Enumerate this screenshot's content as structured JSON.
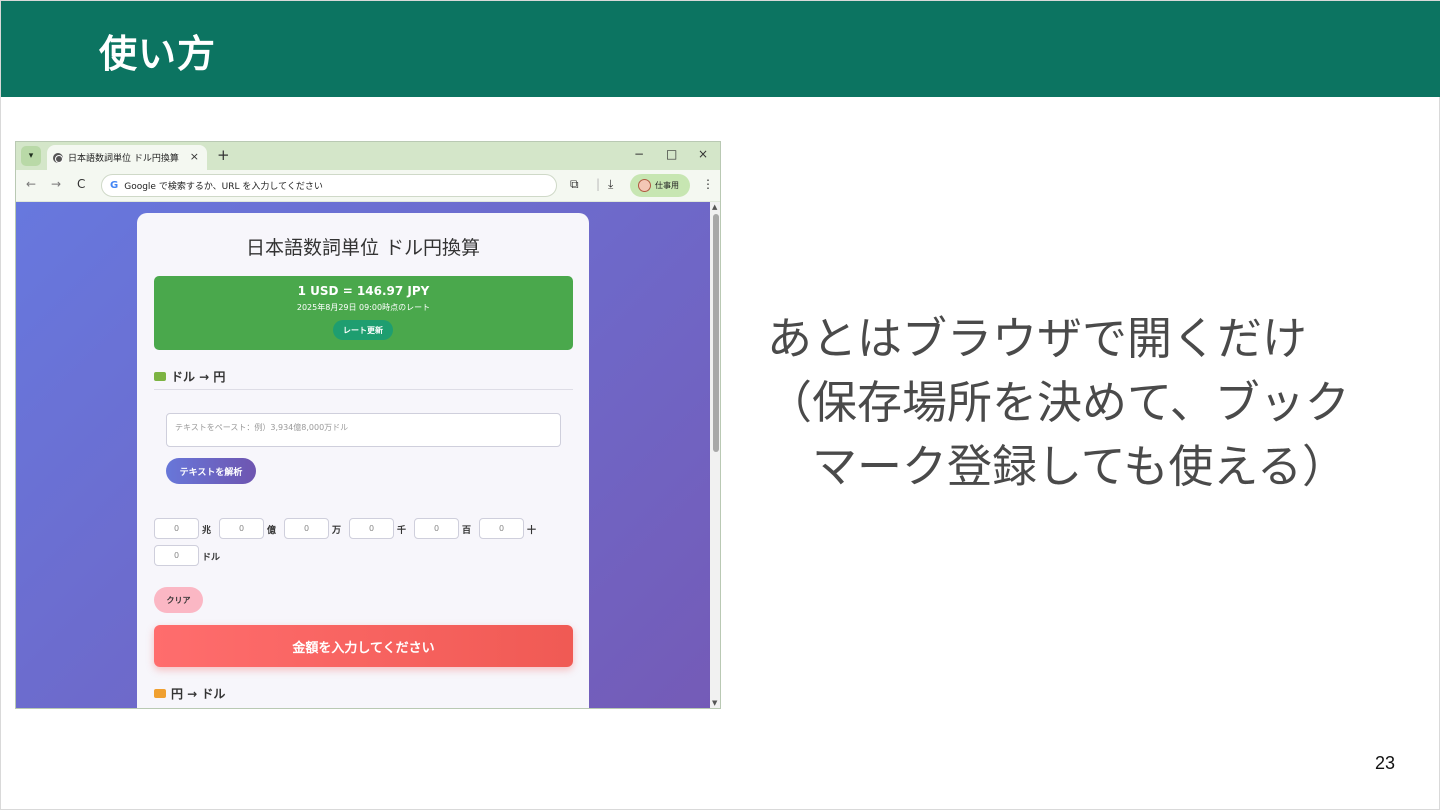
{
  "slide": {
    "title": "使い方",
    "message_lines": [
      "あとはブラウザで開くだけ",
      "（保存場所を決めて、ブック",
      "　マーク登録しても使える）"
    ],
    "page_number": "23",
    "header_color": "#0c7461"
  },
  "browser": {
    "tab_title": "日本語数詞単位 ドル円換算",
    "tab_close": "×",
    "new_tab": "+",
    "window_controls": {
      "minimize": "−",
      "maximize": "□",
      "close": "×"
    },
    "nav": {
      "back": "←",
      "forward": "→",
      "reload": "C"
    },
    "omnibox_google": "G",
    "omnibox_placeholder": "Google で検索するか、URL を入力してください",
    "profile_label": "仕事用",
    "menu": "⋮"
  },
  "app": {
    "title": "日本語数詞単位 ドル円換算",
    "rate": {
      "main": "1 USD = 146.97 JPY",
      "sub": "2025年8月29日 09:00時点のレート",
      "refresh_label": "レート更新",
      "box_color": "#4aa84c"
    },
    "usd_to_jpy": {
      "heading": "ドル → 円",
      "textarea_placeholder": "テキストをペースト：例）3,934億8,000万ドル",
      "parse_label": "テキストを解析",
      "inputs": [
        {
          "value": "0",
          "unit": "兆"
        },
        {
          "value": "0",
          "unit": "億"
        },
        {
          "value": "0",
          "unit": "万"
        },
        {
          "value": "0",
          "unit": "千"
        },
        {
          "value": "0",
          "unit": "百"
        },
        {
          "value": "0",
          "unit": "十"
        },
        {
          "value": "0",
          "unit": "ドル"
        }
      ],
      "clear_label": "クリア",
      "result_label": "金額を入力してください"
    },
    "jpy_to_usd": {
      "heading": "円 → ドル"
    }
  }
}
